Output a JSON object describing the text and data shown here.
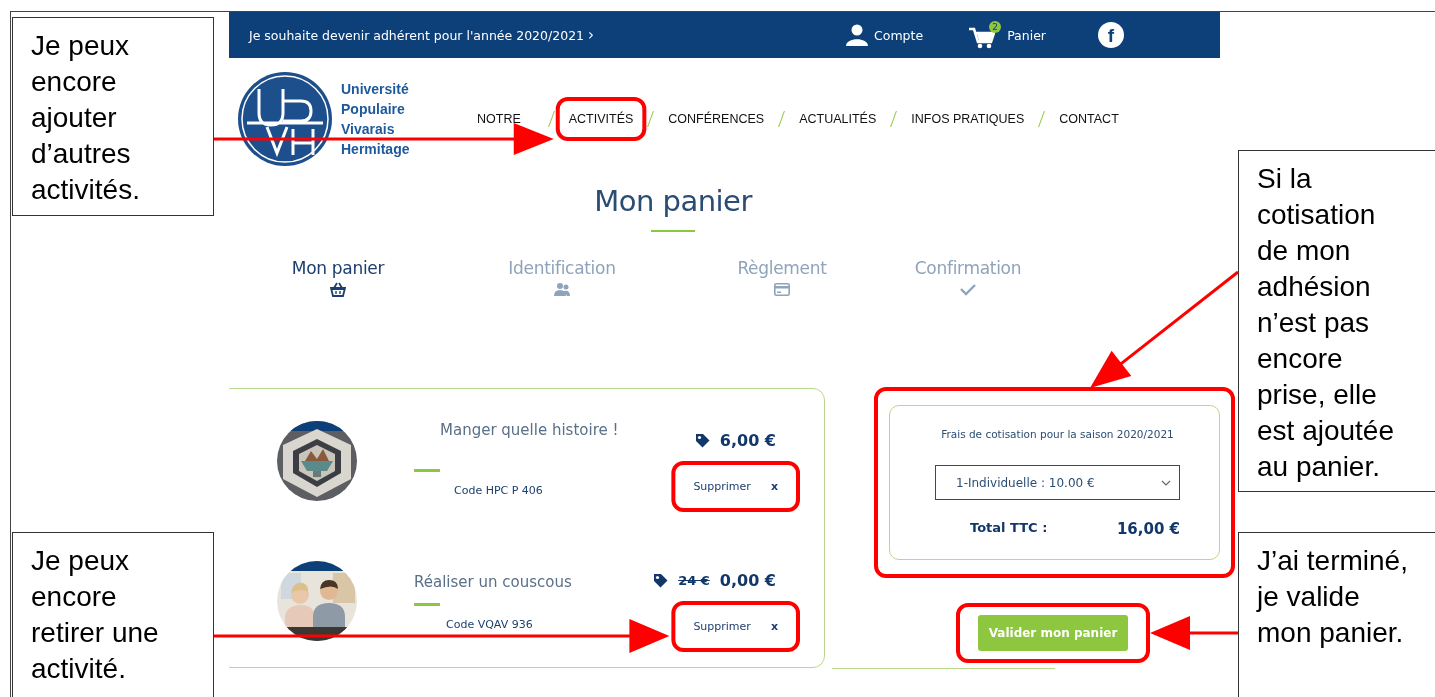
{
  "top_bar": {
    "message": "Je souhaite devenir adhérent pour l'année 2020/2021",
    "message_chevron": "›",
    "account": "Compte",
    "cart_label": "Panier",
    "cart_badge": "2",
    "facebook_glyph": "f"
  },
  "logo_text": "Université Populaire Vivarais Hermitage",
  "nav": [
    "NOTRE",
    "ACTIVITÉS",
    "CONFÉRENCES",
    "ACTUALITÉS",
    "INFOS PRATIQUES",
    "CONTACT"
  ],
  "page_title": "Mon panier",
  "steps": [
    {
      "label": "Mon panier",
      "kind": "basket",
      "selected": true
    },
    {
      "label": "Identification",
      "kind": "users",
      "selected": false
    },
    {
      "label": "Règlement",
      "kind": "card",
      "selected": false
    },
    {
      "label": "Confirmation",
      "kind": "check",
      "selected": false
    }
  ],
  "cart_items": [
    {
      "title": "Manger quelle histoire !",
      "code": "Code HPC P 406",
      "price": "6,00 €",
      "remove_label": "Supprimer",
      "remove_icon": "x",
      "kind": "picture"
    },
    {
      "title": "Réaliser un couscous",
      "code": "Code VQAV 936",
      "old_price": "24 €",
      "price": "0,00 €",
      "remove_label": "Supprimer",
      "remove_icon": "x",
      "kind": "picture"
    }
  ],
  "membership": {
    "label": "Frais de cotisation pour la saison 2020/2021",
    "select_value": "1-Individuelle : 10.00 €",
    "total_label": "Total TTC :",
    "total": "16,00 €"
  },
  "submit_button": "Valider mon panier",
  "annotations": [
    "Je peux encore ajouter d’autres activités.",
    "Je peux encore retirer une activité.",
    "Si la cotisation de mon adhésion n’est pas encore prise, elle est ajoutée au panier.",
    "J’ai terminé, je valide mon panier."
  ]
}
